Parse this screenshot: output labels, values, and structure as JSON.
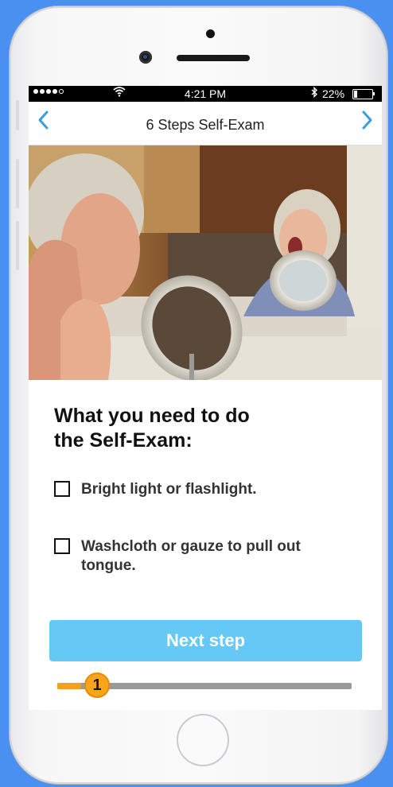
{
  "status_bar": {
    "time": "4:21 PM",
    "battery_percent": "22%",
    "battery_level": 0.22,
    "signal_bars": 4,
    "signal_icon": "signal-dots-icon",
    "wifi_icon": "wifi-icon",
    "bluetooth_icon": "bluetooth-icon",
    "battery_icon": "battery-icon"
  },
  "navbar": {
    "title": "6 Steps Self-Exam",
    "back_icon": "chevron-left-icon",
    "forward_icon": "chevron-right-icon",
    "accent_color": "#3a9de0"
  },
  "content": {
    "heading_line1": "What you need to do",
    "heading_line2": "the Self-Exam:",
    "checklist": [
      {
        "label": "Bright light or flashlight.",
        "checked": false
      },
      {
        "label": "Washcloth or gauze to pull out tongue.",
        "checked": false
      }
    ]
  },
  "actions": {
    "next_label": "Next step",
    "button_color": "#66c8f5"
  },
  "progress": {
    "current_step": "1",
    "total_steps": 6,
    "fraction": 0.08,
    "color": "#f3a020"
  }
}
